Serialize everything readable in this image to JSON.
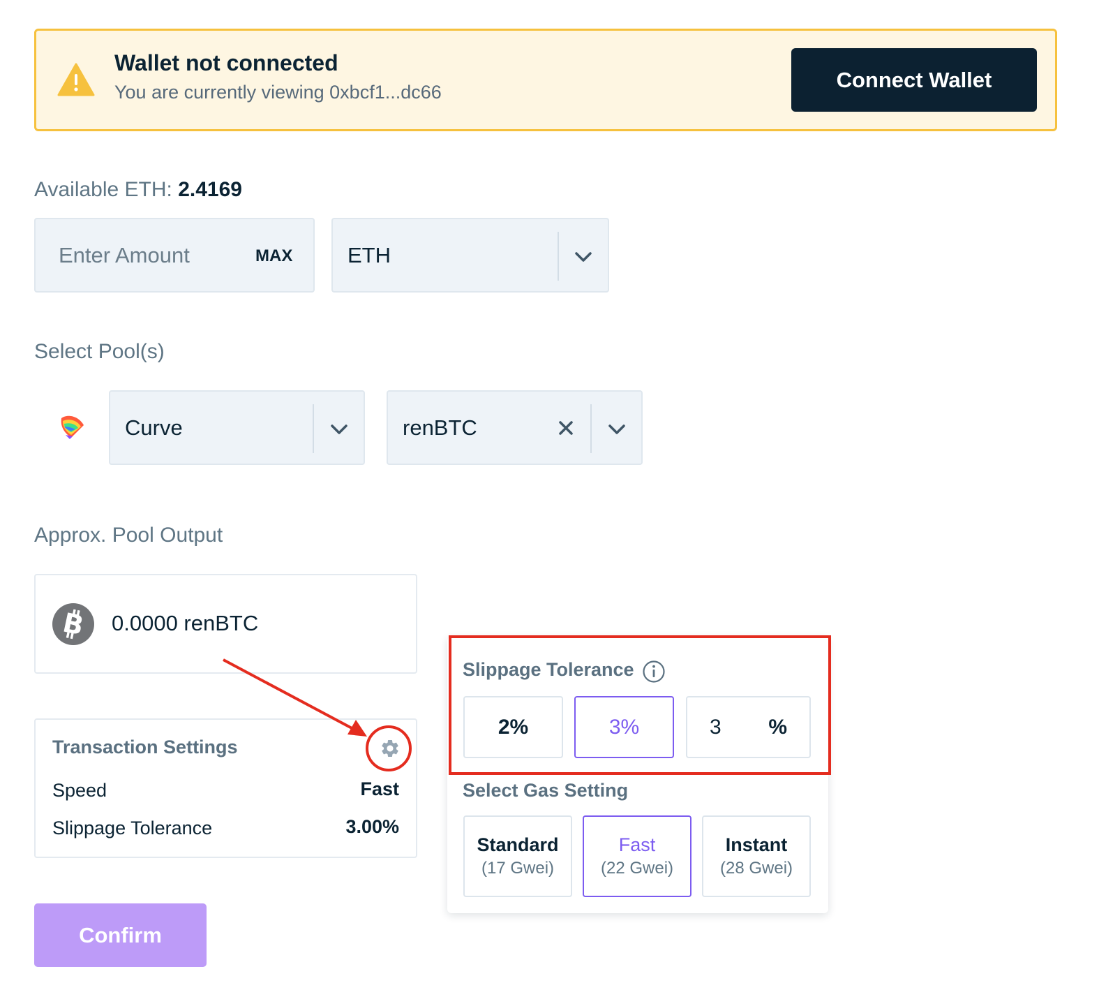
{
  "banner": {
    "title": "Wallet not connected",
    "subtitle": "You are currently viewing 0xbcf1...dc66",
    "connect_label": "Connect Wallet",
    "warning_icon": "warning-triangle-icon"
  },
  "deposit": {
    "available_label": "Available ETH:",
    "available_value": "2.4169",
    "amount_placeholder": "Enter Amount",
    "max_label": "MAX",
    "token_selected": "ETH"
  },
  "pools": {
    "label": "Select Pool(s)",
    "protocol_selected": "Curve",
    "pool_selected": "renBTC",
    "protocol_icon": "curve-logo-icon"
  },
  "output": {
    "label": "Approx. Pool Output",
    "value": "0.0000 renBTC",
    "token_icon": "bitcoin-icon"
  },
  "transaction_settings": {
    "title": "Transaction Settings",
    "rows": [
      {
        "label": "Speed",
        "value": "Fast"
      },
      {
        "label": "Slippage Tolerance",
        "value": "3.00%"
      }
    ]
  },
  "slippage": {
    "title": "Slippage Tolerance",
    "options": [
      "2%",
      "3%"
    ],
    "selected": "3%",
    "custom_value": "3",
    "custom_unit": "%"
  },
  "gas": {
    "title": "Select Gas Setting",
    "options": [
      {
        "label": "Standard",
        "detail": "(17 Gwei)"
      },
      {
        "label": "Fast",
        "detail": "(22 Gwei)"
      },
      {
        "label": "Instant",
        "detail": "(28 Gwei)"
      }
    ],
    "selected": "Fast"
  },
  "confirm_label": "Confirm",
  "colors": {
    "accent": "#7c5cf0",
    "warning_border": "#f6c13e",
    "warning_bg": "#fef6e2",
    "dark": "#0c2131",
    "annotation_red": "#e42c1f"
  }
}
